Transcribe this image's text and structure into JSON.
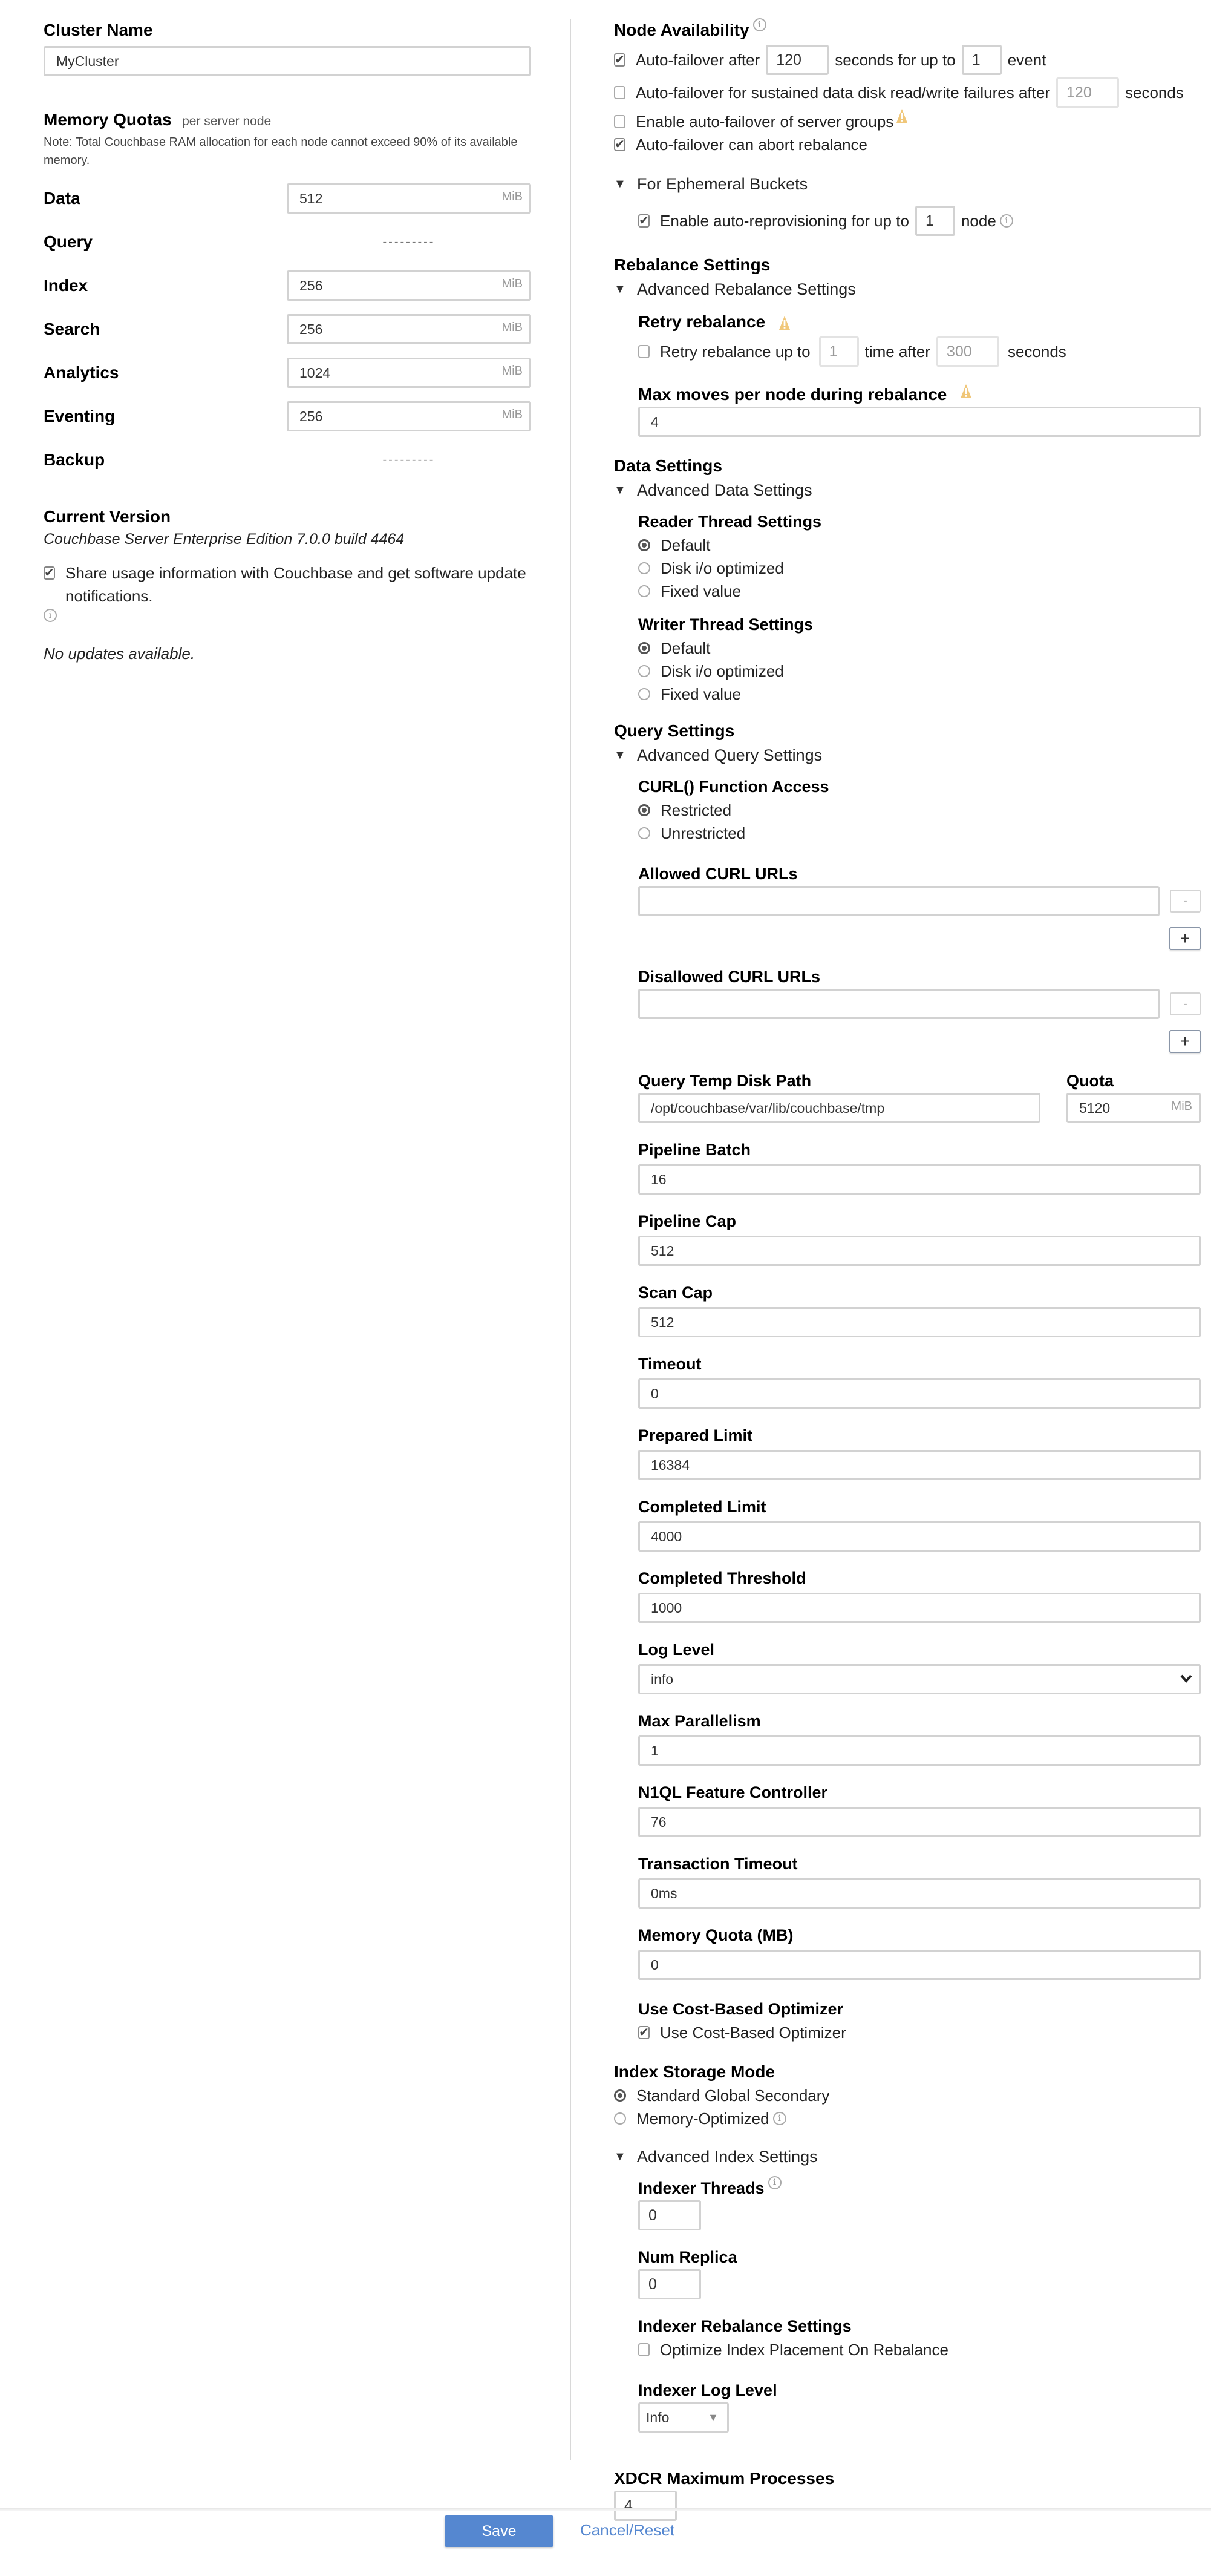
{
  "left": {
    "cluster_name": {
      "label": "Cluster Name",
      "value": "MyCluster"
    },
    "memory_quotas": {
      "title": "Memory Quotas",
      "subtitle": "per server node",
      "note": "Note: Total Couchbase RAM allocation for each node cannot exceed 90% of its available memory.",
      "unit": "MiB",
      "rows": [
        {
          "label": "Data",
          "value": "512",
          "enabled": true
        },
        {
          "label": "Query",
          "value": "---------",
          "enabled": false
        },
        {
          "label": "Index",
          "value": "256",
          "enabled": true
        },
        {
          "label": "Search",
          "value": "256",
          "enabled": true
        },
        {
          "label": "Analytics",
          "value": "1024",
          "enabled": true
        },
        {
          "label": "Eventing",
          "value": "256",
          "enabled": true
        },
        {
          "label": "Backup",
          "value": "---------",
          "enabled": false
        }
      ]
    },
    "version": {
      "title": "Current Version",
      "text": "Couchbase Server Enterprise Edition 7.0.0 build 4464"
    },
    "share_usage": {
      "label": "Share usage information with Couchbase and get software update notifications.",
      "checked": true
    },
    "updates_status": "No updates available."
  },
  "node_availability": {
    "title": "Node Availability",
    "autofailover": {
      "checked": true,
      "label_before": "Auto-failover after",
      "seconds": "120",
      "label_mid": "seconds for up to",
      "events": "1",
      "label_after": "event"
    },
    "disk_failover": {
      "checked": false,
      "label": "Auto-failover for sustained data disk read/write failures after",
      "seconds": "120",
      "label_after": "seconds"
    },
    "server_groups": {
      "checked": false,
      "label": "Enable auto-failover of server groups"
    },
    "abort_rebalance": {
      "checked": true,
      "label": "Auto-failover can abort rebalance"
    },
    "ephemeral": {
      "title": "For Ephemeral Buckets",
      "reprovision": {
        "checked": true,
        "label_before": "Enable auto-reprovisioning for up to",
        "nodes": "1",
        "label_after": "node"
      }
    }
  },
  "rebalance": {
    "title": "Rebalance Settings",
    "advanced_title": "Advanced Rebalance Settings",
    "retry_title": "Retry rebalance",
    "retry": {
      "checked": false,
      "label_before": "Retry rebalance up to",
      "times": "1",
      "label_mid": "time after",
      "seconds": "300",
      "label_after": "seconds"
    },
    "max_moves_label": "Max moves per node during rebalance",
    "max_moves": "4"
  },
  "data_settings": {
    "title": "Data Settings",
    "advanced_title": "Advanced Data Settings",
    "reader": {
      "title": "Reader Thread Settings",
      "options": [
        "Default",
        "Disk i/o optimized",
        "Fixed value"
      ],
      "selected": "Default"
    },
    "writer": {
      "title": "Writer Thread Settings",
      "options": [
        "Default",
        "Disk i/o optimized",
        "Fixed value"
      ],
      "selected": "Default"
    }
  },
  "query_settings": {
    "title": "Query Settings",
    "advanced_title": "Advanced Query Settings",
    "curl_access": {
      "title": "CURL() Function Access",
      "options": [
        "Restricted",
        "Unrestricted"
      ],
      "selected": "Restricted"
    },
    "allowed_urls": {
      "label": "Allowed CURL URLs",
      "value": "",
      "remove": "-",
      "add": "+"
    },
    "disallowed_urls": {
      "label": "Disallowed CURL URLs",
      "value": "",
      "remove": "-",
      "add": "+"
    },
    "temp_path": {
      "label": "Query Temp Disk Path",
      "value": "/opt/couchbase/var/lib/couchbase/tmp"
    },
    "quota": {
      "label": "Quota",
      "value": "5120",
      "unit": "MiB"
    },
    "fields": [
      {
        "label": "Pipeline Batch",
        "value": "16"
      },
      {
        "label": "Pipeline Cap",
        "value": "512"
      },
      {
        "label": "Scan Cap",
        "value": "512"
      },
      {
        "label": "Timeout",
        "value": "0"
      },
      {
        "label": "Prepared Limit",
        "value": "16384"
      },
      {
        "label": "Completed Limit",
        "value": "4000"
      },
      {
        "label": "Completed Threshold",
        "value": "1000"
      }
    ],
    "log_level": {
      "label": "Log Level",
      "value": "info"
    },
    "fields2": [
      {
        "label": "Max Parallelism",
        "value": "1"
      },
      {
        "label": "N1QL Feature Controller",
        "value": "76"
      },
      {
        "label": "Transaction Timeout",
        "value": "0ms"
      },
      {
        "label": "Memory Quota (MB)",
        "value": "0"
      }
    ],
    "cbo": {
      "title": "Use Cost-Based Optimizer",
      "label": "Use Cost-Based Optimizer",
      "checked": true
    }
  },
  "index_storage": {
    "title": "Index Storage Mode",
    "options": [
      "Standard Global Secondary",
      "Memory-Optimized"
    ],
    "selected": "Standard Global Secondary",
    "advanced_title": "Advanced Index Settings",
    "indexer_threads": {
      "label": "Indexer Threads",
      "value": "0"
    },
    "num_replica": {
      "label": "Num Replica",
      "value": "0"
    },
    "rebalance": {
      "title": "Indexer Rebalance Settings",
      "label": "Optimize Index Placement On Rebalance",
      "checked": false
    },
    "log_level": {
      "label": "Indexer Log Level",
      "value": "Info"
    }
  },
  "xdcr": {
    "label": "XDCR Maximum Processes",
    "value": "4"
  },
  "footer": {
    "save": "Save",
    "cancel": "Cancel/Reset"
  },
  "colors": {
    "primary": "#5587d0",
    "warning": "#f0c77a",
    "border": "#d2d2d2"
  },
  "icons": {
    "check": "✔",
    "triangle_down": "▼",
    "chevron_down": "⌄",
    "caret_down": "▼",
    "info": "i"
  }
}
